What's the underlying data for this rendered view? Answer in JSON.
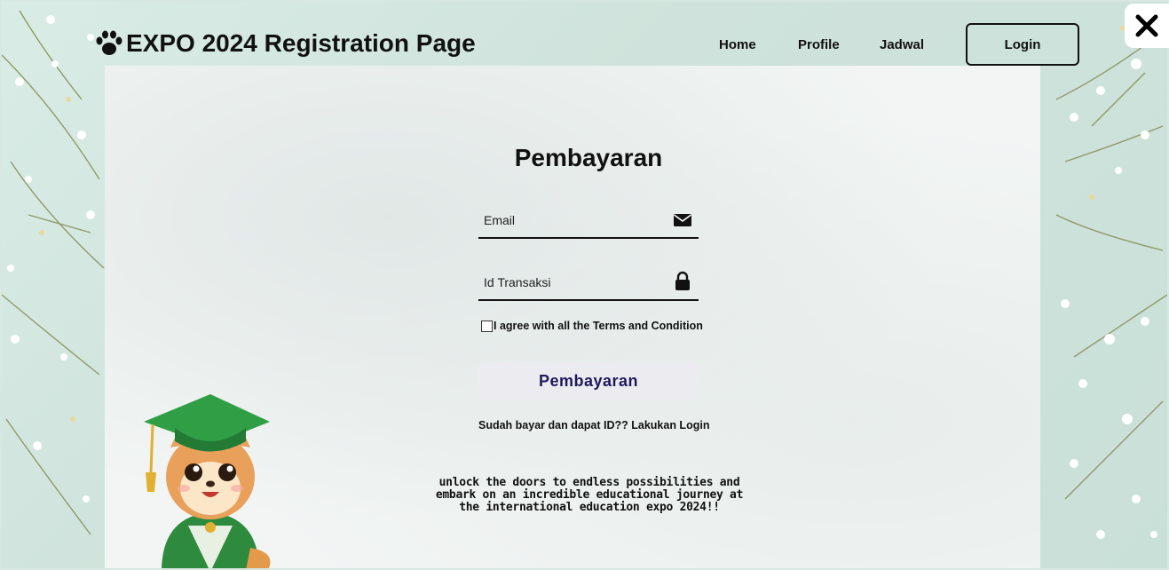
{
  "header": {
    "title": "EXPO 2024 Registration Page",
    "brand_icon": "paw-icon"
  },
  "nav": {
    "items": [
      {
        "label": "Home"
      },
      {
        "label": "Profile"
      },
      {
        "label": "Jadwal"
      }
    ],
    "login_label": "Login",
    "close_icon": "close-icon"
  },
  "form": {
    "title": "Pembayaran",
    "email": {
      "placeholder": "Email",
      "value": "",
      "icon": "envelope-icon"
    },
    "transaction_id": {
      "placeholder": "Id Transaksi",
      "value": "",
      "icon": "lock-icon"
    },
    "terms_label": "I agree with all the Terms and Condition",
    "terms_checked": false,
    "submit_label": "Pembayaran",
    "login_note": "Sudah bayar dan dapat ID?? Lakukan Login"
  },
  "tagline": {
    "line1": "unlock the doors to endless possibilities and",
    "line2": "embark on an incredible educational journey at",
    "line3": "the international education expo 2024!!"
  },
  "colors": {
    "accent": "#1e1a5a",
    "button_bg": "#ecebef",
    "text": "#111111"
  }
}
